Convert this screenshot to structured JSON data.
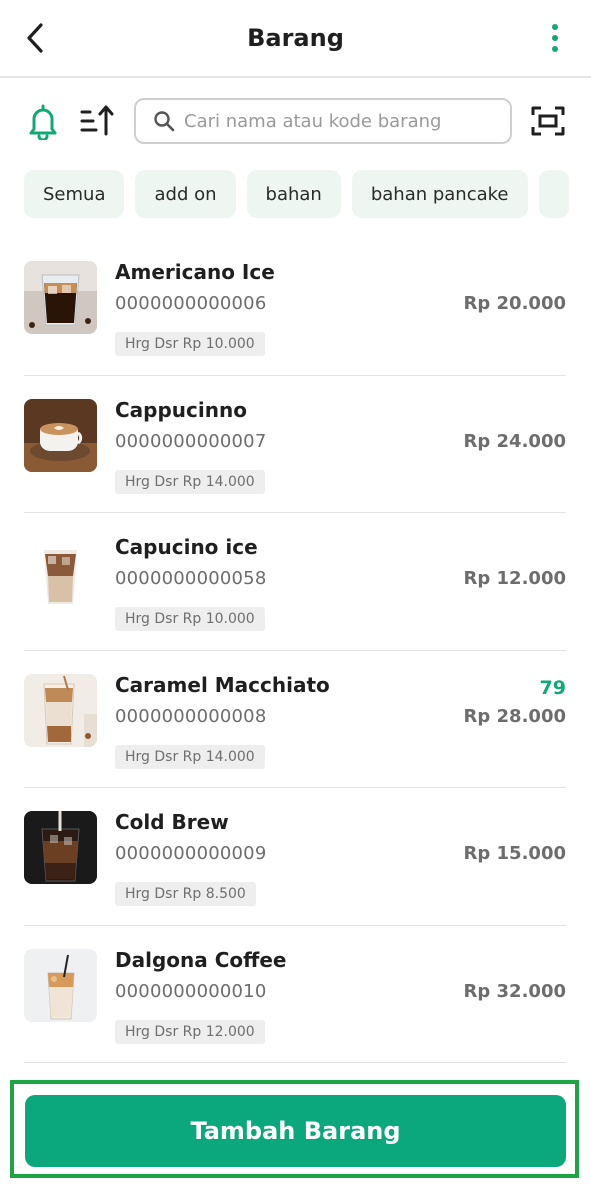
{
  "header": {
    "title": "Barang",
    "back_icon": "chevron-left-icon",
    "menu_icon": "more-vertical-icon"
  },
  "toolbar": {
    "bell_icon": "bell-icon",
    "sort_icon": "sort-icon",
    "scan_icon": "scan-icon",
    "search": {
      "placeholder": "Cari nama atau kode barang",
      "value": ""
    }
  },
  "chips": [
    {
      "label": "Semua"
    },
    {
      "label": "add on"
    },
    {
      "label": "bahan"
    },
    {
      "label": "bahan pancake"
    },
    {
      "label": ""
    }
  ],
  "items": [
    {
      "name": "Americano Ice",
      "code": "0000000000006",
      "base_price": "Hrg Dsr Rp 10.000",
      "price": "Rp 20.000",
      "stock": ""
    },
    {
      "name": "Cappucinno",
      "code": "0000000000007",
      "base_price": "Hrg Dsr Rp 14.000",
      "price": "Rp 24.000",
      "stock": ""
    },
    {
      "name": "Capucino ice",
      "code": "0000000000058",
      "base_price": "Hrg Dsr Rp 10.000",
      "price": "Rp 12.000",
      "stock": ""
    },
    {
      "name": "Caramel Macchiato",
      "code": "0000000000008",
      "base_price": "Hrg Dsr Rp 14.000",
      "price": "Rp 28.000",
      "stock": "79"
    },
    {
      "name": "Cold Brew",
      "code": "0000000000009",
      "base_price": "Hrg Dsr Rp 8.500",
      "price": "Rp 15.000",
      "stock": ""
    },
    {
      "name": "Dalgona Coffee",
      "code": "0000000000010",
      "base_price": "Hrg Dsr Rp 12.000",
      "price": "Rp 32.000",
      "stock": ""
    }
  ],
  "footer": {
    "add_label": "Tambah Barang"
  },
  "colors": {
    "accent": "#0aa87a",
    "highlight_border": "#1da543",
    "chip_bg": "#eef6f2"
  }
}
